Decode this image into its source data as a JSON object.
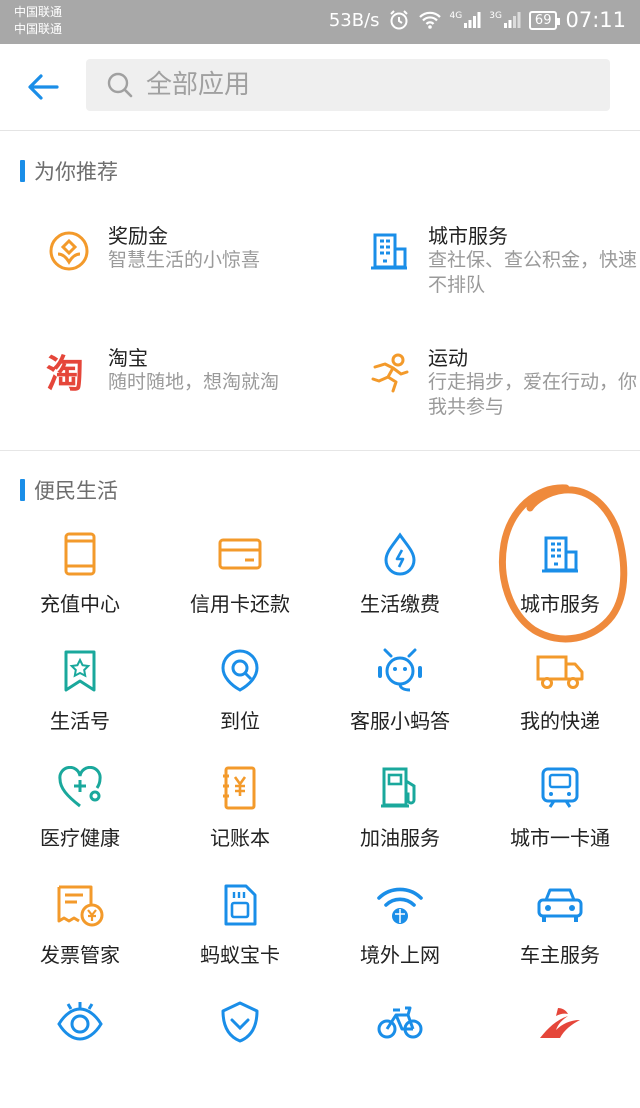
{
  "status_bar": {
    "carrier_1": "中国联通",
    "carrier_2": "中国联通",
    "speed": "53B/s",
    "net_4g": "4G",
    "net_3g": "3G",
    "battery": "69",
    "time": "07:11"
  },
  "search": {
    "placeholder": "全部应用"
  },
  "recommend": {
    "title": "为你推荐",
    "items": [
      {
        "title": "奖励金",
        "desc": "智慧生活的小惊喜",
        "icon": "reward-gold-icon"
      },
      {
        "title": "城市服务",
        "desc": "查社保、查公积金，快速不排队",
        "icon": "city-building-icon"
      },
      {
        "title": "淘宝",
        "desc": "随时随地，想淘就淘",
        "icon": "taobao-icon"
      },
      {
        "title": "运动",
        "desc": "行走捐步，爱在行动，你我共参与",
        "icon": "running-icon"
      }
    ]
  },
  "life": {
    "title": "便民生活",
    "items": [
      {
        "label": "充值中心",
        "icon": "phone-icon"
      },
      {
        "label": "信用卡还款",
        "icon": "credit-card-icon"
      },
      {
        "label": "生活缴费",
        "icon": "water-drop-icon"
      },
      {
        "label": "城市服务",
        "icon": "city-building-icon"
      },
      {
        "label": "生活号",
        "icon": "bookmark-star-icon"
      },
      {
        "label": "到位",
        "icon": "location-pin-icon"
      },
      {
        "label": "客服小蚂答",
        "icon": "ant-service-icon"
      },
      {
        "label": "我的快递",
        "icon": "delivery-truck-icon"
      },
      {
        "label": "医疗健康",
        "icon": "medical-heart-icon"
      },
      {
        "label": "记账本",
        "icon": "ledger-book-icon"
      },
      {
        "label": "加油服务",
        "icon": "fuel-pump-icon"
      },
      {
        "label": "城市一卡通",
        "icon": "bus-card-icon"
      },
      {
        "label": "发票管家",
        "icon": "invoice-icon"
      },
      {
        "label": "蚂蚁宝卡",
        "icon": "sim-card-icon"
      },
      {
        "label": "境外上网",
        "icon": "wifi-globe-icon"
      },
      {
        "label": "车主服务",
        "icon": "car-icon"
      },
      {
        "label": "",
        "icon": "eye-icon"
      },
      {
        "label": "",
        "icon": "shield-chevron-icon"
      },
      {
        "label": "",
        "icon": "bicycle-icon"
      },
      {
        "label": "",
        "icon": "bird-logo-icon"
      }
    ]
  },
  "colors": {
    "accent": "#1a8ee8",
    "orange": "#f39a2b",
    "red": "#e5463a",
    "annotation": "#ef8a3c"
  }
}
